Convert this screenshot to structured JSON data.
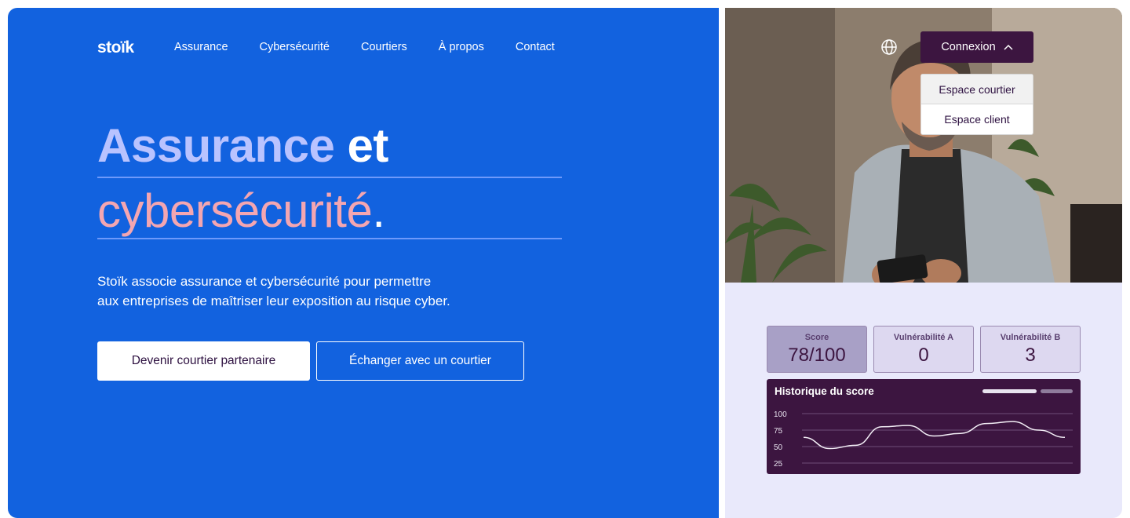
{
  "brand": {
    "logo": "stoïk"
  },
  "nav": [
    "Assurance",
    "Cybersécurité",
    "Courtiers",
    "À propos",
    "Contact"
  ],
  "hero": {
    "heading_part1": "Assurance",
    "heading_part2": "et",
    "heading_part3": "cybersécurité",
    "heading_period": ".",
    "lead_line1": "Stoïk associe assurance et cybersécurité pour permettre",
    "lead_line2": "aux entreprises de maîtriser leur exposition au risque cyber.",
    "cta_primary": "Devenir courtier partenaire",
    "cta_secondary": "Échanger avec un courtier"
  },
  "header_right": {
    "login_label": "Connexion",
    "login_menu": [
      "Espace courtier",
      "Espace client"
    ]
  },
  "dashboard": {
    "cards": [
      {
        "label": "Score",
        "value": "78/100"
      },
      {
        "label": "Vulnérabilité A",
        "value": "0"
      },
      {
        "label": "Vulnérabilité B",
        "value": "3"
      }
    ],
    "chart_title": "Historique du score"
  },
  "chart_data": {
    "type": "line",
    "title": "Historique du score",
    "xlabel": "",
    "ylabel": "",
    "yticks": [
      100,
      75,
      50,
      25
    ],
    "ylim": [
      25,
      100
    ],
    "series": [
      {
        "values": [
          64,
          47,
          52,
          80,
          82,
          66,
          70,
          85,
          88,
          75,
          64
        ]
      }
    ],
    "grid": true
  },
  "colors": {
    "hero_bg": "#1262df",
    "accent_pink": "#f4a6b1",
    "heading_light": "#b9c3ff",
    "dark_purple": "#3c1540",
    "dashboard_bg": "#e9e9fb"
  }
}
